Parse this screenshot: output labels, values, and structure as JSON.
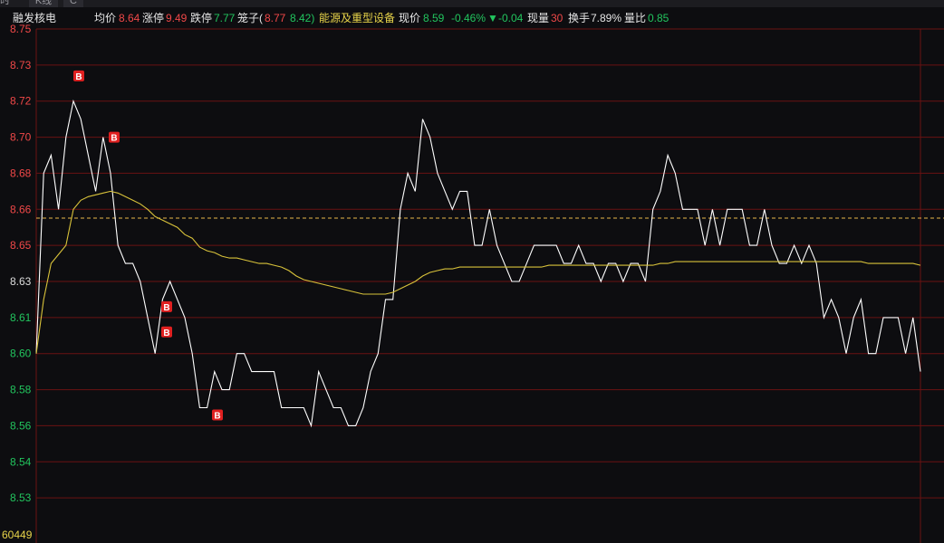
{
  "tabs": [
    {
      "label": "时"
    },
    {
      "label": "K线"
    },
    {
      "label": "C"
    }
  ],
  "info": {
    "stock_name": "融发核电",
    "avg_label": "均价",
    "avg_value": "8.64",
    "limit_up_label": "涨停",
    "limit_up_value": "9.49",
    "limit_down_label": "跌停",
    "limit_down_value": "7.77",
    "cage_label": "笼子(",
    "cage_high": "8.77",
    "cage_low": "8.42)",
    "sector": "能源及重型设备",
    "price_label": "现价",
    "price_value": "8.59",
    "change_pct": "-0.46%",
    "change_arrow": "▼",
    "change_abs": "-0.04",
    "volume_label": "现量",
    "volume_value": "30",
    "turnover_label": "换手",
    "turnover_value": "7.89%",
    "volratio_label": "量比",
    "volratio_value": "0.85"
  },
  "colors": {
    "up": "#f04848",
    "down": "#22c55e",
    "price_line": "#ffffff",
    "avg_line": "#d8c23a",
    "grid": "#6a1212",
    "prev_close": "#e8b84a",
    "marker_bg": "#e02020"
  },
  "chart_data": {
    "type": "line",
    "y_ticks": [
      {
        "value": 8.75,
        "label": "8.75",
        "side": "up"
      },
      {
        "value": 8.73,
        "label": "8.73",
        "side": "up"
      },
      {
        "value": 8.72,
        "label": "8.72",
        "side": "up"
      },
      {
        "value": 8.7,
        "label": "8.70",
        "side": "up"
      },
      {
        "value": 8.68,
        "label": "8.68",
        "side": "up"
      },
      {
        "value": 8.66,
        "label": "8.66",
        "side": "up"
      },
      {
        "value": 8.65,
        "label": "8.65",
        "side": "up"
      },
      {
        "value": 8.63,
        "label": "8.63",
        "side": "flat"
      },
      {
        "value": 8.61,
        "label": "8.61",
        "side": "down"
      },
      {
        "value": 8.6,
        "label": "8.60",
        "side": "down"
      },
      {
        "value": 8.58,
        "label": "8.58",
        "side": "down"
      },
      {
        "value": 8.56,
        "label": "8.56",
        "side": "down"
      },
      {
        "value": 8.54,
        "label": "8.54",
        "side": "down"
      },
      {
        "value": 8.53,
        "label": "8.53",
        "side": "down"
      }
    ],
    "volume_axis_label": "60449",
    "prev_close": 8.63,
    "series": [
      {
        "values": [
          8.6,
          8.68,
          8.69,
          8.66,
          8.7,
          8.72,
          8.71,
          8.69,
          8.67,
          8.7,
          8.68,
          8.65,
          8.64,
          8.64,
          8.63,
          8.61,
          8.6,
          8.62,
          8.63,
          8.62,
          8.61,
          8.6,
          8.57,
          8.57,
          8.59,
          8.58,
          8.58,
          8.6,
          8.6,
          8.59,
          8.59,
          8.59,
          8.59,
          8.57,
          8.57,
          8.57,
          8.57,
          8.56,
          8.59,
          8.58,
          8.57,
          8.57,
          8.56,
          8.56,
          8.57,
          8.59,
          8.6,
          8.62,
          8.62,
          8.66,
          8.68,
          8.67,
          8.71,
          8.7,
          8.68,
          8.67,
          8.66,
          8.67,
          8.67,
          8.65,
          8.65,
          8.66,
          8.65,
          8.64,
          8.63,
          8.63,
          8.64,
          8.65,
          8.65,
          8.65,
          8.65,
          8.64,
          8.64,
          8.65,
          8.64,
          8.64,
          8.63,
          8.64,
          8.64,
          8.63,
          8.64,
          8.64,
          8.63,
          8.66,
          8.67,
          8.69,
          8.68,
          8.66,
          8.66,
          8.66,
          8.65,
          8.66,
          8.65,
          8.66,
          8.66,
          8.66,
          8.65,
          8.65,
          8.66,
          8.65,
          8.64,
          8.64,
          8.65,
          8.64,
          8.65,
          8.64,
          8.61,
          8.62,
          8.61,
          8.6,
          8.61,
          8.62,
          8.6,
          8.6,
          8.61,
          8.61,
          8.61,
          8.6,
          8.61,
          8.59
        ]
      },
      {
        "values": [
          8.6,
          8.62,
          8.64,
          8.645,
          8.65,
          8.66,
          8.665,
          8.667,
          8.668,
          8.669,
          8.67,
          8.669,
          8.667,
          8.665,
          8.663,
          8.66,
          8.658,
          8.657,
          8.656,
          8.655,
          8.653,
          8.652,
          8.649,
          8.647,
          8.646,
          8.644,
          8.643,
          8.643,
          8.642,
          8.641,
          8.64,
          8.64,
          8.639,
          8.638,
          8.636,
          8.633,
          8.631,
          8.63,
          8.629,
          8.628,
          8.627,
          8.626,
          8.625,
          8.624,
          8.623,
          8.623,
          8.623,
          8.623,
          8.624,
          8.626,
          8.628,
          8.63,
          8.633,
          8.635,
          8.636,
          8.637,
          8.637,
          8.638,
          8.638,
          8.638,
          8.638,
          8.638,
          8.638,
          8.638,
          8.638,
          8.638,
          8.638,
          8.638,
          8.638,
          8.639,
          8.639,
          8.639,
          8.639,
          8.639,
          8.639,
          8.639,
          8.639,
          8.639,
          8.639,
          8.639,
          8.639,
          8.639,
          8.639,
          8.639,
          8.64,
          8.64,
          8.641,
          8.641,
          8.641,
          8.641,
          8.641,
          8.641,
          8.641,
          8.641,
          8.641,
          8.641,
          8.641,
          8.641,
          8.641,
          8.641,
          8.641,
          8.641,
          8.641,
          8.641,
          8.641,
          8.641,
          8.641,
          8.641,
          8.641,
          8.641,
          8.641,
          8.641,
          8.64,
          8.64,
          8.64,
          8.64,
          8.64,
          8.64,
          8.64,
          8.639
        ]
      }
    ],
    "buy_markers": [
      {
        "label": "B",
        "value": 8.727
      },
      {
        "label": "B",
        "value": 8.7
      },
      {
        "label": "B",
        "value": 8.616
      },
      {
        "label": "B",
        "value": 8.606
      },
      {
        "label": "B",
        "value": 8.566
      }
    ]
  }
}
